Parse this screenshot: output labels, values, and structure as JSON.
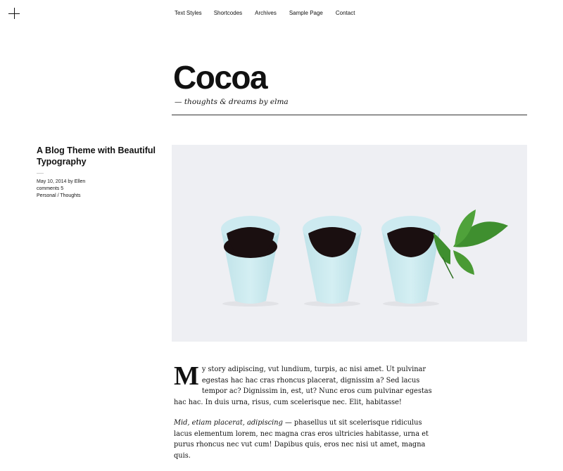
{
  "menu": {
    "toggle_icon": "plus-icon"
  },
  "nav": {
    "items": [
      {
        "label": "Text Styles"
      },
      {
        "label": "Shortcodes"
      },
      {
        "label": "Archives"
      },
      {
        "label": "Sample Page"
      },
      {
        "label": "Contact"
      }
    ]
  },
  "header": {
    "title": "Cocoa",
    "tagline": "— thoughts & dreams by elma"
  },
  "post": {
    "title": "A Blog Theme with Beautiful Typography",
    "date": "May 10, 2014",
    "by": "by",
    "author": "Ellen",
    "comments": "comments 5",
    "categories": "Personal / Thoughts",
    "image": {
      "name": "three-coffee-cups-photo",
      "background": "#eeeff3",
      "cup_color": "#c9e9ee",
      "coffee_color": "#1a0f10",
      "leaf_color": "#3f8f2f"
    },
    "dropcap": "M",
    "para1": "y story adipiscing, vut lundium, turpis, ac nisi amet. Ut pulvinar egestas hac hac cras rhoncus placerat, dignissim a? Sed lacus tempor ac? Dignissim in, est, ut? Nunc eros cum pulvinar egestas hac hac. In duis urna, risus, cum scelerisque nec. Elit, habitasse!",
    "para2_italic": "Mid, etiam placerat, adipiscing",
    "para2": " — phasellus ut sit scelerisque ridiculus lacus elementum lorem, nec magna cras eros ultricies habitasse, urna et purus rhoncus nec vut cum! Dapibus quis, eros nec nisi ut amet, magna quis."
  }
}
